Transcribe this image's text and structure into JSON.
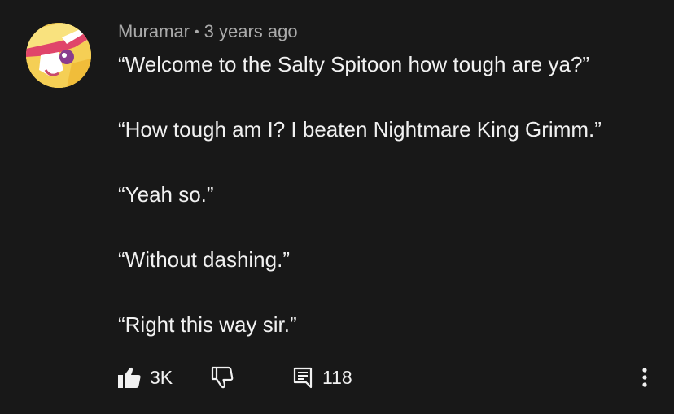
{
  "comment": {
    "author": "Muramar",
    "separator": "•",
    "timestamp": "3 years ago",
    "lines": [
      "“Welcome to the Salty Spitoon how tough are ya?”",
      "“How tough am I? I beaten Nightmare King Grimm.”",
      "“Yeah so.”",
      "“Without dashing.”",
      "“Right this way sir.”"
    ],
    "like_count": "3K",
    "reply_count": "118"
  },
  "icons": {
    "like": "thumbs-up-icon",
    "dislike": "thumbs-down-icon",
    "reply": "comment-icon",
    "more": "more-vert-icon"
  },
  "colors": {
    "background": "#181818",
    "text": "#f1f1f1",
    "meta_text": "#aaaaaa"
  }
}
